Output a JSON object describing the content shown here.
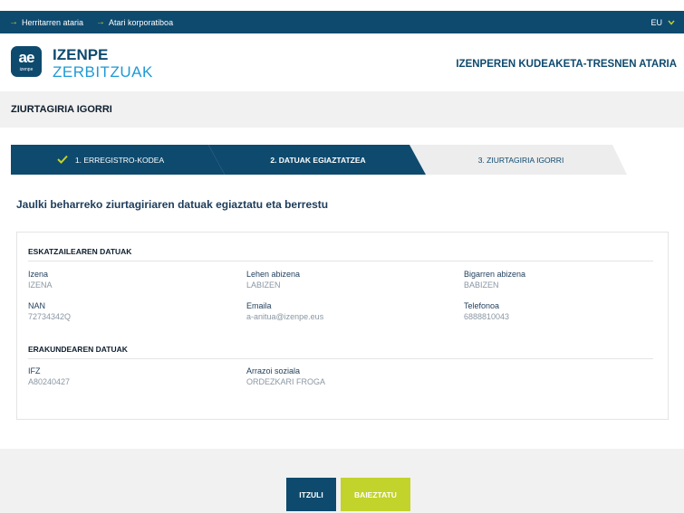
{
  "topbar": {
    "links": [
      "Herritarren ataria",
      "Atari korporatiboa"
    ],
    "language": "EU"
  },
  "header": {
    "logo_mark": "ae",
    "logo_sub": "izenpe",
    "brand_line1": "IZENPE",
    "brand_line2": "ZERBITZUAK",
    "portal_title": "IZENPEREN KUDEAKETA-TRESNEN ATARIA"
  },
  "page": {
    "title": "ZIURTAGIRIA IGORRI"
  },
  "steps": [
    {
      "label": "1. ERREGISTRO-KODEA",
      "state": "done"
    },
    {
      "label": "2. DATUAK EGIAZTATZEA",
      "state": "active"
    },
    {
      "label": "3. ZIURTAGIRIA IGORRI",
      "state": "pending"
    }
  ],
  "subtitle": "Jaulki beharreko ziurtagiriaren datuak egiaztatu eta berrestu",
  "applicant": {
    "title": "ESKATZAILEAREN DATUAK",
    "fields": [
      {
        "label": "Izena",
        "value": "IZENA"
      },
      {
        "label": "Lehen abizena",
        "value": "LABIZEN"
      },
      {
        "label": "Bigarren abizena",
        "value": "BABIZEN"
      },
      {
        "label": "NAN",
        "value": "72734342Q"
      },
      {
        "label": "Emaila",
        "value": "a-anitua@izenpe.eus"
      },
      {
        "label": "Telefonoa",
        "value": "6888810043"
      }
    ]
  },
  "organization": {
    "title": "ERAKUNDEAREN DATUAK",
    "fields": [
      {
        "label": "IFZ",
        "value": "A80240427"
      },
      {
        "label": "Arrazoi soziala",
        "value": "ORDEZKARI FROGA"
      }
    ]
  },
  "buttons": {
    "back": "ITZULI",
    "confirm": "BAIEZTATU"
  },
  "colors": {
    "navy": "#0e4a6e",
    "lime": "#c2d32b",
    "light_blue": "#1d9ad6",
    "grey_bg": "#f1f1f1"
  },
  "icons": {
    "top_link": "arrow-right-icon",
    "language": "chevron-down-icon",
    "step_done": "check-icon"
  }
}
